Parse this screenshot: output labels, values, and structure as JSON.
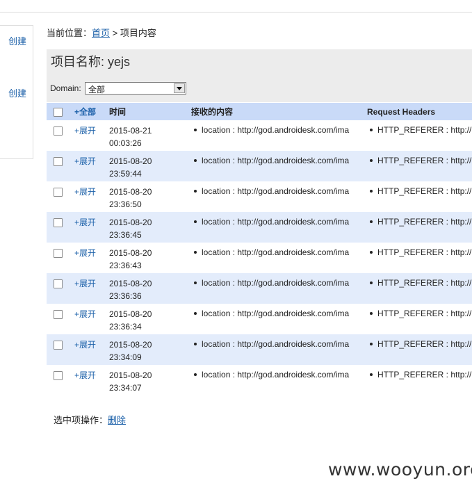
{
  "sidebar": {
    "items": [
      {
        "label": "创建"
      },
      {
        "label": "创建"
      }
    ]
  },
  "breadcrumb": {
    "prefix": "当前位置：",
    "home": "首页",
    "separator": " > ",
    "current": "项目内容"
  },
  "project": {
    "title": "项目名称: yejs"
  },
  "domain_filter": {
    "label": "Domain:",
    "selected": "全部"
  },
  "table": {
    "headers": {
      "expand_all": "+全部",
      "time": "时间",
      "content": "接收的内容",
      "request_headers": "Request Headers"
    },
    "rows": [
      {
        "expand": "+展开",
        "date": "2015-08-21",
        "time": "00:03:26",
        "content": "location : http://god.androidesk.com/ima",
        "headers": "HTTP_REFERER : http://"
      },
      {
        "expand": "+展开",
        "date": "2015-08-20",
        "time": "23:59:44",
        "content": "location : http://god.androidesk.com/ima",
        "headers": "HTTP_REFERER : http://"
      },
      {
        "expand": "+展开",
        "date": "2015-08-20",
        "time": "23:36:50",
        "content": "location : http://god.androidesk.com/ima",
        "headers": "HTTP_REFERER : http://"
      },
      {
        "expand": "+展开",
        "date": "2015-08-20",
        "time": "23:36:45",
        "content": "location : http://god.androidesk.com/ima",
        "headers": "HTTP_REFERER : http://"
      },
      {
        "expand": "+展开",
        "date": "2015-08-20",
        "time": "23:36:43",
        "content": "location : http://god.androidesk.com/ima",
        "headers": "HTTP_REFERER : http://"
      },
      {
        "expand": "+展开",
        "date": "2015-08-20",
        "time": "23:36:36",
        "content": "location : http://god.androidesk.com/ima",
        "headers": "HTTP_REFERER : http://"
      },
      {
        "expand": "+展开",
        "date": "2015-08-20",
        "time": "23:36:34",
        "content": "location : http://god.androidesk.com/ima",
        "headers": "HTTP_REFERER : http://"
      },
      {
        "expand": "+展开",
        "date": "2015-08-20",
        "time": "23:34:09",
        "content": "location : http://god.androidesk.com/ima",
        "headers": "HTTP_REFERER : http://"
      },
      {
        "expand": "+展开",
        "date": "2015-08-20",
        "time": "23:34:07",
        "content": "location : http://god.androidesk.com/ima",
        "headers": "HTTP_REFERER : http://"
      }
    ]
  },
  "bulk_actions": {
    "label": "选中项操作：",
    "delete": "删除"
  },
  "watermark": "www.wooyun.org",
  "colors": {
    "link": "#1a5fa8",
    "header_bg": "#c9daf8",
    "row_alt_bg": "#e3ecfb",
    "panel_bg": "#ececec"
  }
}
